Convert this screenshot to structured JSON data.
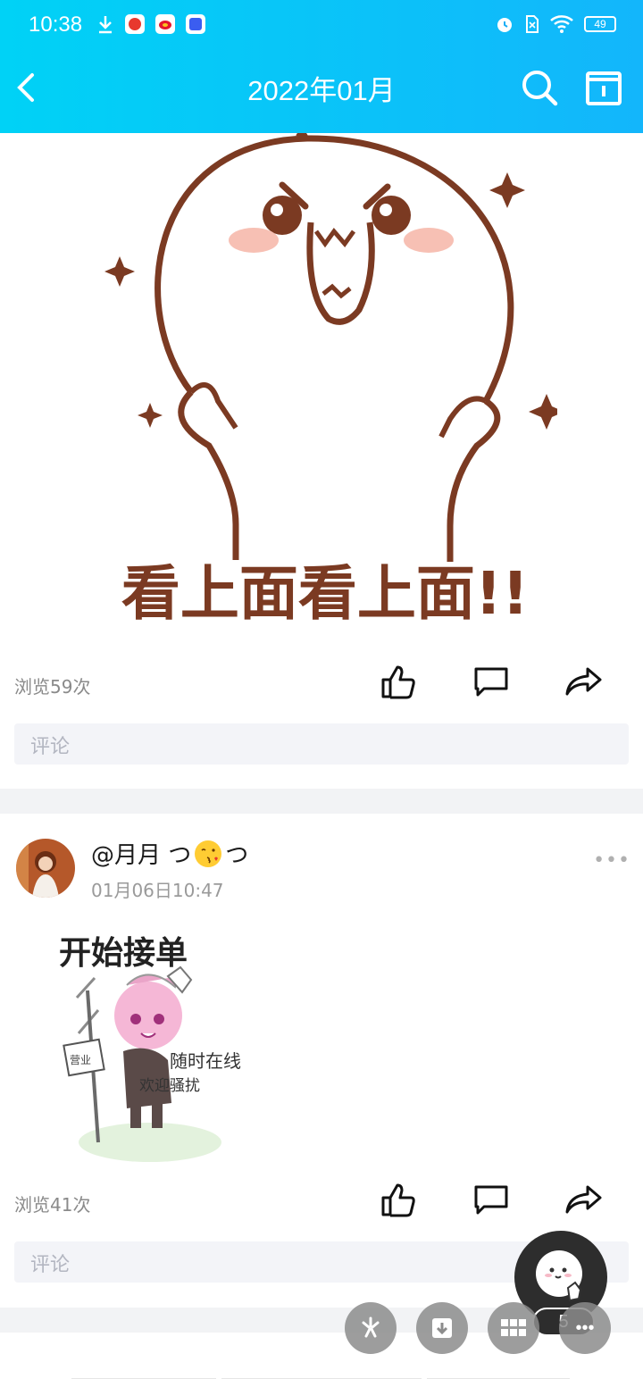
{
  "status_bar": {
    "time": "10:38",
    "battery": "49",
    "app_icons": [
      "download-icon",
      "app-icon-red",
      "weibo-icon",
      "tieba-icon"
    ],
    "system_icons": [
      "alarm-icon",
      "sim-icon",
      "wifi-icon",
      "battery-icon"
    ]
  },
  "header": {
    "title": "2022年01月",
    "background": "#13b6fb"
  },
  "posts": [
    {
      "sticker_text": "看上面看上面!!",
      "views": "浏览59次",
      "comment_placeholder": "评论"
    },
    {
      "username": "@月月 つ",
      "username_suffix": "つ",
      "time": "01月06日10:47",
      "more": "•••",
      "sticker_title": "开始接单",
      "sticker_sign": "营业",
      "sticker_line1": "随时在线",
      "sticker_line2": "欢迎骚扰",
      "views": "浏览41次",
      "comment_placeholder": "评论"
    }
  ],
  "fab": {
    "badge": "5",
    "more": "•••"
  },
  "colors": {
    "brown": "#7b3a22",
    "accent": "#13b6fb",
    "gray_text": "#8a8a8a"
  }
}
